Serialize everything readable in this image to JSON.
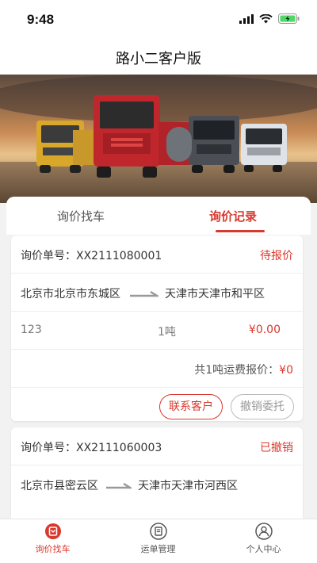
{
  "status_bar": {
    "time": "9:48"
  },
  "app": {
    "title": "路小二客户版"
  },
  "tabs": [
    {
      "label": "询价找车",
      "active": false
    },
    {
      "label": "询价记录",
      "active": true
    }
  ],
  "orders": [
    {
      "number_label": "询价单号：XX2111080001",
      "status": "待报价",
      "from": "北京市北京市东城区",
      "to": "天津市天津市和平区",
      "goods": "123",
      "weight": "1吨",
      "price": "¥0.00",
      "summary_prefix": "共1吨运费报价：",
      "summary_price": "¥0",
      "buttons": {
        "contact": "联系客户",
        "cancel": "撤销委托"
      }
    },
    {
      "number_label": "询价单号：XX2111060003",
      "status": "已撤销",
      "from": "北京市县密云区",
      "to": "天津市天津市河西区"
    }
  ],
  "bottom_nav": [
    {
      "label": "询价找车",
      "icon": "inquiry-icon",
      "active": true
    },
    {
      "label": "运单管理",
      "icon": "waybill-icon",
      "active": false
    },
    {
      "label": "个人中心",
      "icon": "user-icon",
      "active": false
    }
  ],
  "colors": {
    "accent": "#d9382d",
    "background": "#f2f2f2"
  }
}
